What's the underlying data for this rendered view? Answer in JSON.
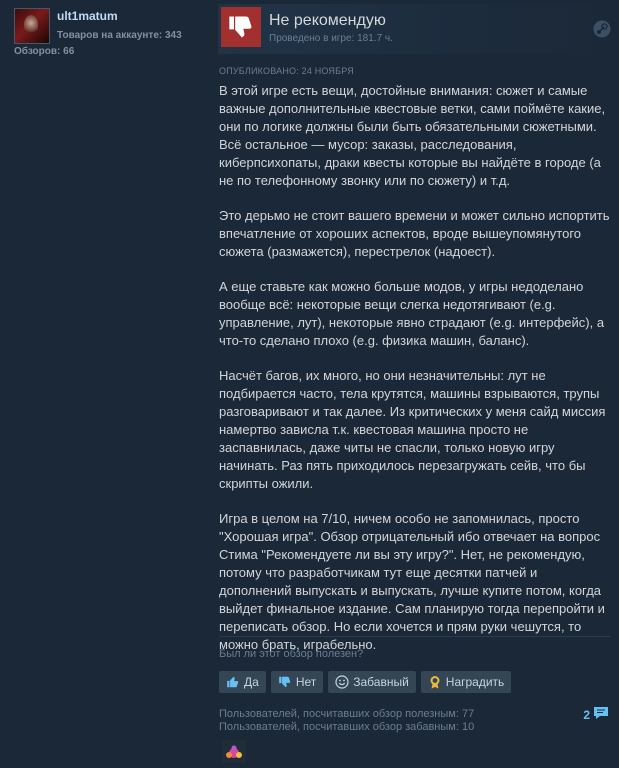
{
  "author": {
    "name": "ult1matum",
    "products": "Товаров на аккаунте: 343",
    "reviews": "Обзоров: 66"
  },
  "review": {
    "rating": "Не рекомендую",
    "playtime": "Проведено в игре: 181.7 ч.",
    "posted": "Опубликовано: 24 ноября",
    "paragraphs": [
      "В этой игре есть вещи, достойные внимания: сюжет и самые важные дополнительные квестовые ветки, сами поймёте какие, они по логике должны были быть обязательными сюжетными. Всё остальное — мусор: заказы, расследования, киберпсихопаты, драки квесты которые вы найдёте в городе (а не по телефонному звонку или по сюжету) и т.д.",
      "Это дерьмо не стоит вашего времени и может сильно испортить впечатление от хороших аспектов, вроде вышеупомянутого сюжета (размажется), перестрелок (надоест).",
      "А еще ставьте как можно больше модов, у игры недоделано вообще всё: некоторые вещи слегка недотягивают (e.g. управление, лут), некоторые явно страдают (e.g. интерфейс), а что-то сделано плохо (e.g. физика машин, баланс).",
      "Насчёт багов, их много, но они незначительны: лут не подбирается часто, тела крутятся, машины взрываются, трупы разговаривают и так далее. Из критических у меня сайд миссия намертво зависла т.к. квестовая машина просто не заспавнилась, даже читы не спасли, только новую игру начинать. Раз пять приходилось перезагружать сейв, что бы скрипты ожили.",
      "Игра в целом на 7/10, ничем особо не запомнилась, просто \"Хорошая игра\". Обзор отрицательный ибо отвечает на вопрос Стима \"Рекомендуете ли вы эту игру?\". Нет, не рекомендую, потому что разработчикам тут еще десятки патчей и дополнений выпускать и выпускать, лучше купите потом, когда выйдет финальное издание. Сам планирую тогда перепройти и переписать обзор. Но если хочется и прям руки чешутся, то можно брать, играбельно."
    ]
  },
  "feedback": {
    "question": "Был ли этот обзор полезен?",
    "yes": "Да",
    "no": "Нет",
    "funny": "Забавный",
    "award": "Наградить",
    "helpful_stat": "Пользователей, посчитавших обзор полезным: 77",
    "funny_stat": "Пользователей, посчитавших обзор забавным: 10",
    "comments": "2"
  },
  "colors": {
    "background": "#1b2838",
    "not_recommended": "#a1302e",
    "link": "#66c0f4"
  },
  "icons": [
    "thumbs-down-icon",
    "steam-icon",
    "thumbs-up-icon",
    "smiley-icon",
    "award-icon",
    "comment-icon"
  ]
}
